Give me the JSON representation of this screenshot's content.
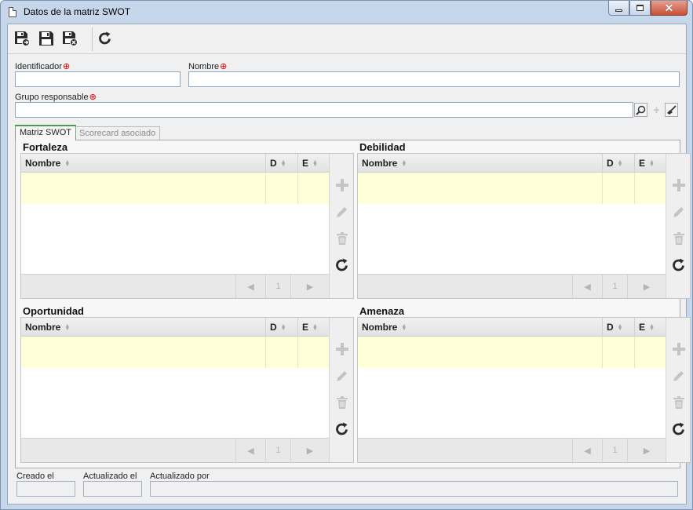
{
  "window": {
    "title": "Datos de la matriz SWOT"
  },
  "toolbar": {
    "save_new_icon": "save-and-new-icon",
    "save_icon": "save-icon",
    "save_close_icon": "save-and-close-icon",
    "refresh_icon": "refresh-icon"
  },
  "form": {
    "identificador_label": "Identificador",
    "identificador_value": "",
    "nombre_label": "Nombre",
    "nombre_value": "",
    "grupo_label": "Grupo responsable",
    "grupo_value": ""
  },
  "tabs": [
    {
      "label": "Matriz SWOT",
      "active": true
    },
    {
      "label": "Scorecard asociado",
      "active": false
    }
  ],
  "quadrants": {
    "fortaleza": {
      "title": "Fortaleza"
    },
    "debilidad": {
      "title": "Debilidad"
    },
    "oportunidad": {
      "title": "Oportunidad"
    },
    "amenaza": {
      "title": "Amenaza"
    }
  },
  "grid": {
    "col_nombre": "Nombre",
    "col_d": "D",
    "col_e": "E",
    "page": "1"
  },
  "footer": {
    "creado_label": "Creado el",
    "creado_value": "",
    "actualizado_label": "Actualizado el",
    "actualizado_value": "",
    "actualizado_por_label": "Actualizado por",
    "actualizado_por_value": ""
  },
  "colors": {
    "selected_row": "#ffffd9",
    "required_marker": "#dd0000",
    "active_tab_accent": "#4d9a4d"
  }
}
